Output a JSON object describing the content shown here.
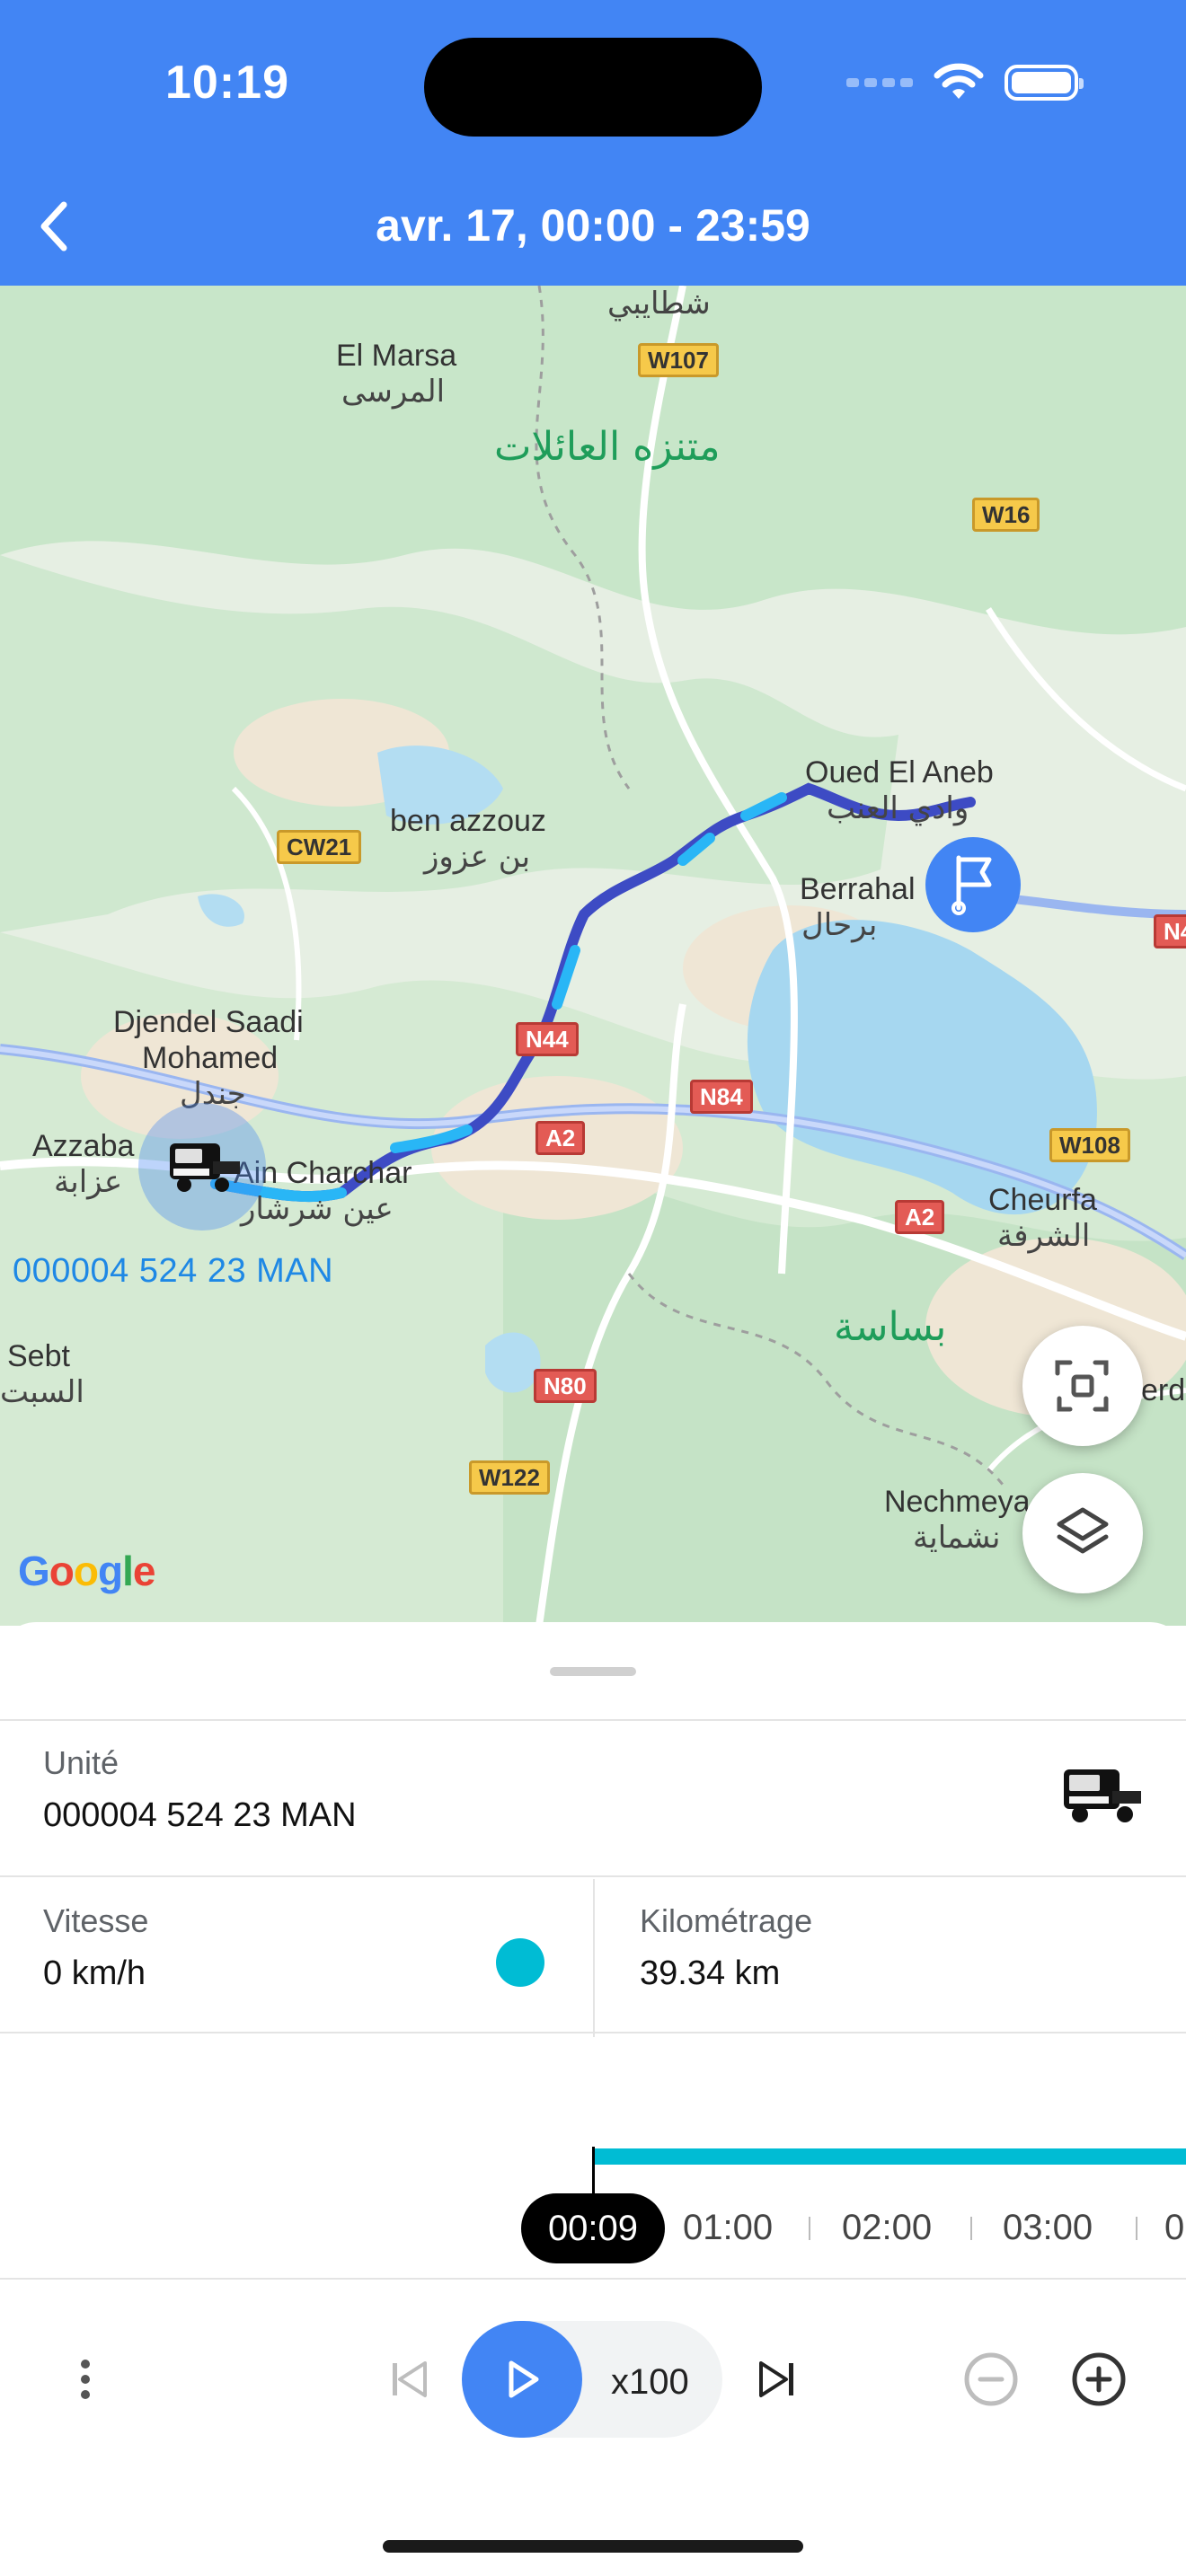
{
  "status_bar": {
    "time": "10:19"
  },
  "header": {
    "title": "avr. 17, 00:00 - 23:59",
    "back_icon": "chevron-left-icon"
  },
  "map": {
    "places": [
      {
        "text": "شطايبي",
        "id": "place-chetaibi-ar"
      },
      {
        "text": "El Marsa",
        "id": "place-el-marsa"
      },
      {
        "text": "المرسى",
        "id": "place-el-marsa-ar"
      },
      {
        "text": "متنزه العائلات",
        "id": "place-park-ar"
      },
      {
        "text": "Oued El Aneb",
        "id": "place-oued-el-aneb"
      },
      {
        "text": "وادي العنب",
        "id": "place-oued-el-aneb-ar"
      },
      {
        "text": "ben azzouz",
        "id": "place-ben-azzouz"
      },
      {
        "text": "بن عزوز",
        "id": "place-ben-azzouz-ar"
      },
      {
        "text": "Berrahal",
        "id": "place-berrahal"
      },
      {
        "text": "برحال",
        "id": "place-berrahal-ar"
      },
      {
        "text": "Djendel Saadi",
        "id": "place-djendel"
      },
      {
        "text": "Mohamed",
        "id": "place-mohamed"
      },
      {
        "text": "جندل",
        "id": "place-djendel-ar"
      },
      {
        "text": "Azzaba",
        "id": "place-azzaba"
      },
      {
        "text": "عزابة",
        "id": "place-azzaba-ar"
      },
      {
        "text": "Ain Charchar",
        "id": "place-ain-charchar"
      },
      {
        "text": "عين شرشار",
        "id": "place-ain-charchar-ar"
      },
      {
        "text": "Cheurfa",
        "id": "place-cheurfa"
      },
      {
        "text": "الشرفة",
        "id": "place-cheurfa-ar"
      },
      {
        "text": "بساسة",
        "id": "place-bsasa-ar"
      },
      {
        "text": "Sebt",
        "id": "place-sebt"
      },
      {
        "text": "السبت",
        "id": "place-sebt-ar"
      },
      {
        "text": "Nechmeya",
        "id": "place-nechmeya"
      },
      {
        "text": "نشماية",
        "id": "place-nechmeya-ar"
      },
      {
        "text": "erda",
        "id": "place-erda"
      }
    ],
    "roads": [
      "W107",
      "W16",
      "CW21",
      "N44",
      "N84",
      "A2",
      "A2",
      "W108",
      "N80",
      "W122",
      "N4"
    ],
    "unit_label": "000004 524 23 MAN",
    "google_logo": "Google",
    "fab_focus_icon": "focus-center-icon",
    "fab_layers_icon": "layers-icon",
    "route_colors": {
      "fast": "#3d4bc4",
      "slow": "#29b6f6"
    }
  },
  "sheet": {
    "unit": {
      "label": "Unité",
      "value": "000004 524 23 MAN"
    },
    "speed": {
      "label": "Vitesse",
      "value": "0 km/h",
      "indicator_color": "#00bcd4"
    },
    "mileage": {
      "label": "Kilométrage",
      "value": "39.34 km"
    },
    "timeline": {
      "current": "00:09",
      "ticks": [
        "01:00",
        "02:00",
        "03:00",
        "0"
      ]
    },
    "controls": {
      "menu_icon": "more-vertical-icon",
      "prev_icon": "skip-previous-icon",
      "play_icon": "play-icon",
      "speed": "x100",
      "next_icon": "skip-next-icon",
      "zoom_out_icon": "zoom-out-icon",
      "zoom_in_icon": "zoom-in-icon"
    }
  }
}
